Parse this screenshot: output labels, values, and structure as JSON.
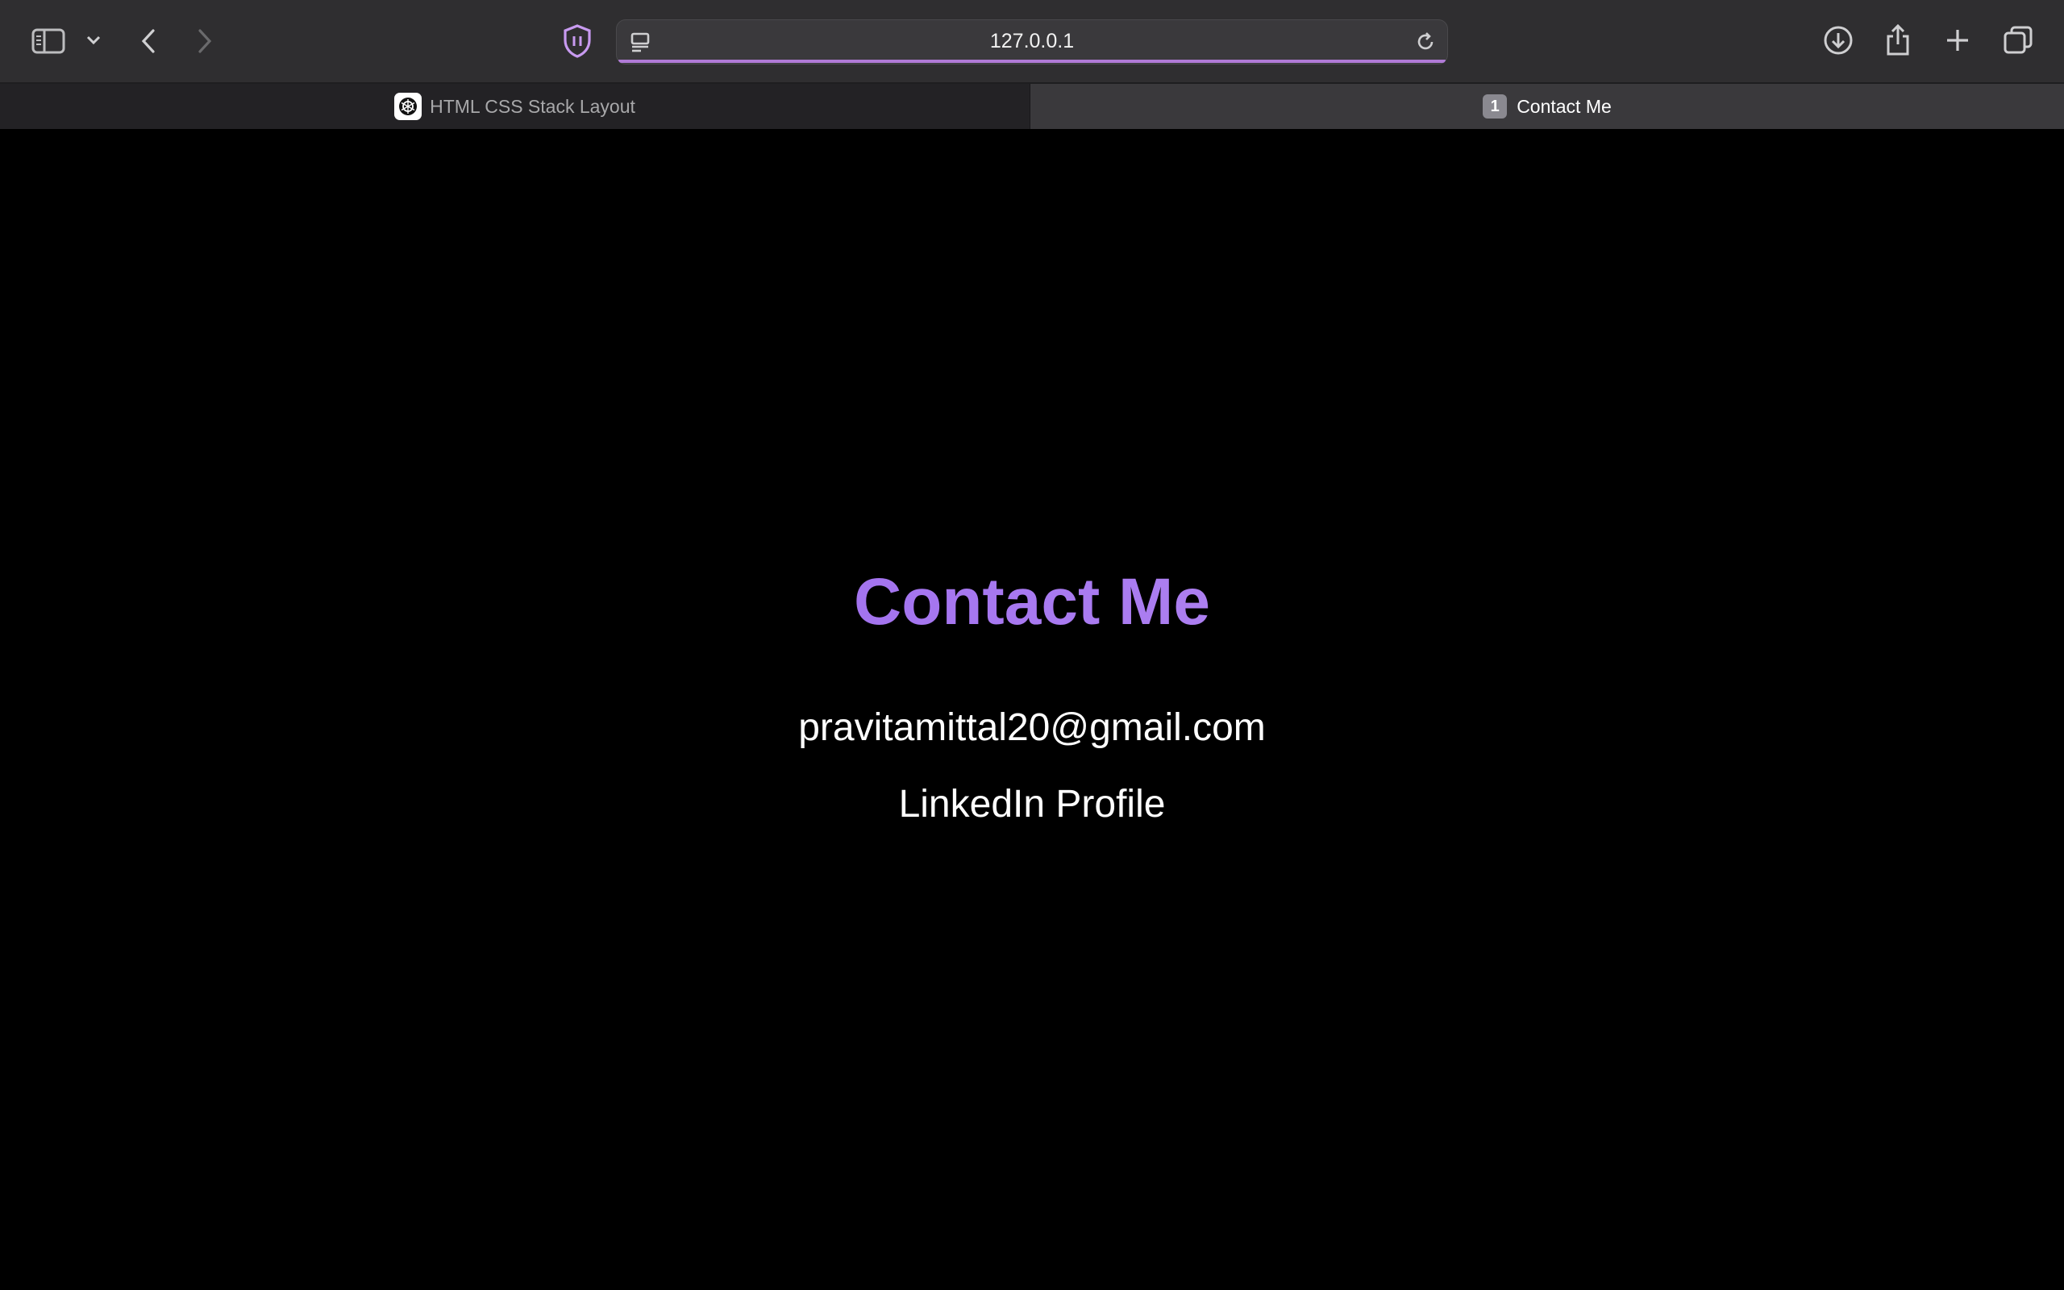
{
  "browser": {
    "address": "127.0.0.1",
    "tabs": [
      {
        "label": "HTML CSS Stack Layout",
        "active": false
      },
      {
        "label": "Contact Me",
        "active": true,
        "badge": "1"
      }
    ],
    "colors": {
      "accent": "#b07ad6",
      "toolbar": "#2f2e30"
    }
  },
  "page": {
    "title": "Contact Me",
    "email": "pravitamittal20@gmail.com",
    "linkedin_label": "LinkedIn Profile",
    "colors": {
      "background": "#000000",
      "title_gradient_start": "#8a58e6",
      "title_gradient_end": "#c09cf2",
      "text": "#ffffff"
    }
  }
}
